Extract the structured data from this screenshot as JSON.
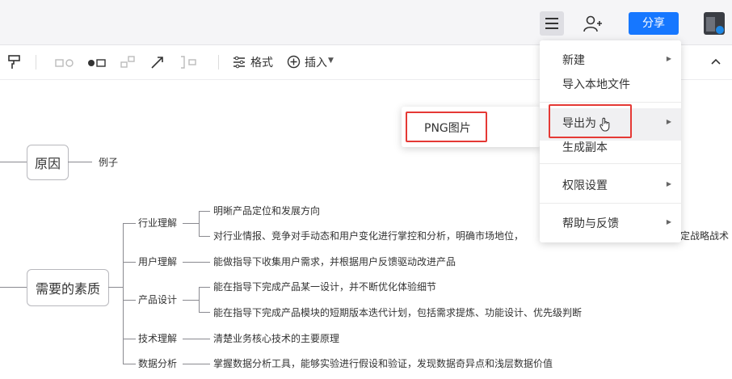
{
  "header": {
    "share_label": "分享",
    "menu_icon": "hamburger-icon",
    "add_user_icon": "add-user-icon"
  },
  "toolbar": {
    "format_label": "格式",
    "insert_label": "插入"
  },
  "menu": {
    "items": [
      {
        "label": "新建"
      },
      {
        "label": "导入本地文件"
      },
      {
        "label": "导出为"
      },
      {
        "label": "生成副本"
      },
      {
        "label": "权限设置"
      },
      {
        "label": "帮助与反馈"
      }
    ],
    "highlighted": "导出为"
  },
  "submenu": {
    "items": [
      {
        "label": "PNG图片"
      }
    ]
  },
  "mindmap": {
    "cause": {
      "label": "原因",
      "children": [
        {
          "label": "例子"
        }
      ]
    },
    "qualities": {
      "label": "需要的素质",
      "groups": [
        {
          "label": "行业理解",
          "items": [
            {
              "label": "明晰产品定位和发展方向"
            },
            {
              "label": "对行业情报、竞争对手动态和用户变化进行掌控和分析，明确市场地位，"
            },
            {
              "label": "确定战略战术"
            }
          ]
        },
        {
          "label": "用户理解",
          "items": [
            {
              "label": "能做指导下收集用户需求，并根据用户反馈驱动改进产品"
            }
          ]
        },
        {
          "label": "产品设计",
          "items": [
            {
              "label": "能在指导下完成产品某一设计，并不断优化体验细节"
            },
            {
              "label": "能在指导下完成产品模块的短期版本迭代计划，包括需求提炼、功能设计、优先级判断"
            }
          ]
        },
        {
          "label": "技术理解",
          "items": [
            {
              "label": "清楚业务核心技术的主要原理"
            }
          ]
        },
        {
          "label": "数据分析",
          "items": [
            {
              "label": "掌握数据分析工具，能够实验进行假设和验证，发现数据奇异点和浅层数据价值"
            }
          ]
        }
      ]
    }
  },
  "colors": {
    "accent": "#1677ff",
    "highlight": "#e53935"
  }
}
